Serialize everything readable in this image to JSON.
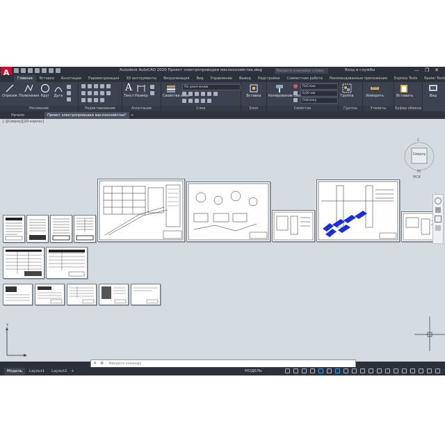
{
  "app": {
    "logo_letter": "A",
    "title": "Autodesk AutoCAD 2020   Проект электропроводки маслохозяйства.dwg",
    "search_placeholder": "Введите ключевое слово/фразу",
    "sign_in": "Вход в службы",
    "window_controls": [
      "—",
      "❐",
      "✕"
    ]
  },
  "ribbon": {
    "tabs": [
      "Главная",
      "Вставка",
      "Аннотации",
      "Параметризация",
      "3D инструменты",
      "Визуализация",
      "Вид",
      "Управление",
      "Вывод",
      "Надстройки",
      "Совместная работа",
      "Рекомендованные приложения",
      "Express Tools",
      "Raster Tools"
    ],
    "active_tab": "Главная",
    "panels": {
      "draw": {
        "title": "Рисование",
        "tools": [
          "Отрезок",
          "Полилиния",
          "Круг",
          "Дуга"
        ]
      },
      "modify": {
        "title": "Редактирование"
      },
      "annotation": {
        "title": "Аннотации",
        "tools": [
          "Текст",
          "Размер"
        ]
      },
      "layers": {
        "title": "Слои",
        "tools": [
          "Свойства слоя"
        ],
        "layer_combo": "По умолчанию"
      },
      "block": {
        "title": "Блок",
        "tools": [
          "Вставка"
        ]
      },
      "properties": {
        "title": "Свойства",
        "tools": [
          "Копирование свойств"
        ],
        "combos": [
          "ПоСлою",
          "0,00 мм",
          "ПоБлоку"
        ]
      },
      "groups": {
        "title": "Группы",
        "tools": [
          "Группа"
        ]
      },
      "utilities": {
        "title": "Утилиты",
        "tools": [
          "Измерить"
        ]
      },
      "clipboard": {
        "title": "Буфер обмена",
        "tools": [
          "Вставить"
        ]
      },
      "view": {
        "tools": [
          "Вид"
        ]
      }
    }
  },
  "file_tabs": [
    "Начало",
    "Проект электропроводки маслохозяйства*",
    "+"
  ],
  "viewport": {
    "label": "[-][Сверху][2D-каркас]",
    "viewcube": {
      "face": "Сверху",
      "north": "С",
      "south": "Ю",
      "wcs": "МСК"
    },
    "ucs_x": "X",
    "ucs_y": "Y"
  },
  "command_line": {
    "placeholder": "Введите команду"
  },
  "status_bar": {
    "tabs": [
      "Модель",
      "Layout1",
      "Layout2",
      "+"
    ],
    "active": "Модель",
    "model_label": "МОДЕЛЬ"
  },
  "colors": {
    "window_bg": "#2b303a",
    "ribbon_bg": "#3c4250",
    "drawing_bg": "#d4dce1",
    "autocad_red": "#c8102e",
    "hatch_blue": "#1a2fd8"
  }
}
